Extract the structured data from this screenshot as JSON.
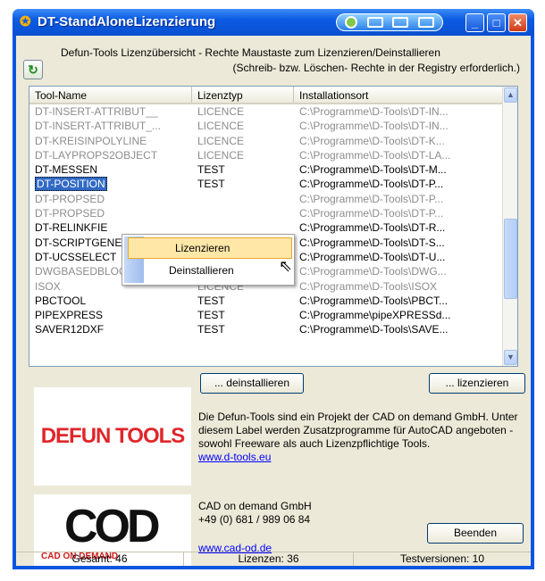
{
  "window": {
    "title": "DT-StandAloneLizenzierung"
  },
  "header": {
    "line1": "Defun-Tools Lizenzübersicht - Rechte Maustaste zum Lizenzieren/Deinstallieren",
    "line2": "(Schreib- bzw. Löschen- Rechte in der Registry erforderlich.)"
  },
  "list": {
    "columns": [
      "Tool-Name",
      "Lizenztyp",
      "Installationsort"
    ],
    "rows": [
      {
        "name": "DT-INSERT-ATTRIBUT__",
        "type": "LICENCE",
        "path": "C:\\Programme\\D-Tools\\DT-IN...",
        "state": "gray"
      },
      {
        "name": "DT-INSERT-ATTRIBUT_...",
        "type": "LICENCE",
        "path": "C:\\Programme\\D-Tools\\DT-IN...",
        "state": "gray"
      },
      {
        "name": "DT-KREISINPOLYLINE",
        "type": "LICENCE",
        "path": "C:\\Programme\\D-Tools\\DT-K...",
        "state": "gray"
      },
      {
        "name": "DT-LAYPROPS2OBJECT",
        "type": "LICENCE",
        "path": "C:\\Programme\\D-Tools\\DT-LA...",
        "state": "gray"
      },
      {
        "name": "DT-MESSEN",
        "type": "TEST",
        "path": "C:\\Programme\\D-Tools\\DT-M...",
        "state": "normal"
      },
      {
        "name": "DT-POSITION",
        "type": "TEST",
        "path": "C:\\Programme\\D-Tools\\DT-P...",
        "state": "selected"
      },
      {
        "name": "DT-PROPSED",
        "type": "",
        "path": "C:\\Programme\\D-Tools\\DT-P...",
        "state": "gray"
      },
      {
        "name": "DT-PROPSED",
        "type": "",
        "path": "C:\\Programme\\D-Tools\\DT-P...",
        "state": "gray"
      },
      {
        "name": "DT-RELINKFIE",
        "type": "",
        "path": "C:\\Programme\\D-Tools\\DT-R...",
        "state": "normal"
      },
      {
        "name": "DT-SCRIPTGENERATOR",
        "type": "TEST",
        "path": "C:\\Programme\\D-Tools\\DT-S...",
        "state": "normal"
      },
      {
        "name": "DT-UCSSELECT",
        "type": "TEST",
        "path": "C:\\Programme\\D-Tools\\DT-U...",
        "state": "normal"
      },
      {
        "name": "DWGBASEDBLOCKBIBO",
        "type": "",
        "path": "C:\\Programme\\D-Tools\\DWG...",
        "state": "gray"
      },
      {
        "name": "ISOX",
        "type": "LICENCE",
        "path": "C:\\Programme\\D-Tools\\ISOX",
        "state": "gray"
      },
      {
        "name": "PBCTOOL",
        "type": "TEST",
        "path": "C:\\Programme\\D-Tools\\PBCT...",
        "state": "normal"
      },
      {
        "name": "PIPEXPRESS",
        "type": "TEST",
        "path": "C:\\Programme\\pipeXPRESSd...",
        "state": "normal"
      },
      {
        "name": "SAVER12DXF",
        "type": "TEST",
        "path": "C:\\Programme\\D-Tools\\SAVE...",
        "state": "normal"
      }
    ]
  },
  "context_menu": {
    "items": [
      "Lizenzieren",
      "Deinstallieren"
    ]
  },
  "buttons": {
    "deinstall": "... deinstallieren",
    "license": "... lizenzieren",
    "close": "Beenden"
  },
  "info": {
    "description": "Die Defun-Tools sind ein Projekt der CAD on demand GmbH. Unter diesem Label werden Zusatzprogramme für AutoCAD angeboten - sowohl Freeware als auch Lizenzpflichtige Tools.",
    "link1": "www.d-tools.eu",
    "company": "CAD on demand GmbH",
    "phone": "+49 (0) 681 / 989 06 84",
    "link2": "www.cad-od.de"
  },
  "logos": {
    "defun": "DEFUN TOOLS",
    "cod": "COD",
    "cod_sub": "CAD ON DEMAND"
  },
  "status": {
    "total": "Gesamt: 46",
    "licenses": "Lizenzen: 36",
    "tests": "Testversionen: 10"
  },
  "colors": {
    "titlebar": "#0a56e0",
    "selection": "#316ac5",
    "menu_highlight": "#ffe7a8",
    "logo_red": "#e0262a",
    "link": "#0000ff"
  }
}
